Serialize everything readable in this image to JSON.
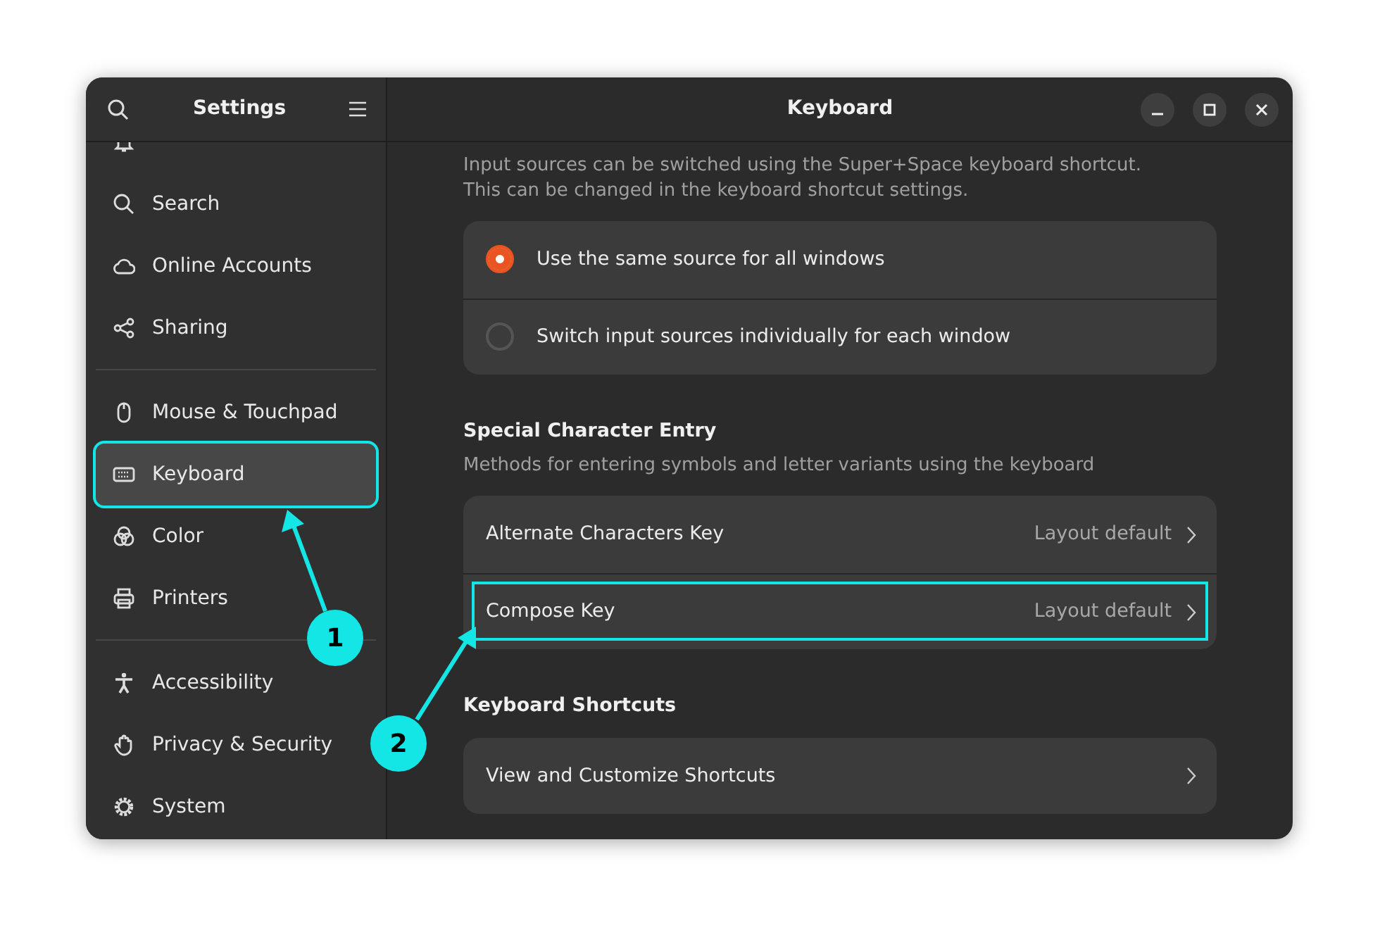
{
  "sidebar": {
    "title": "Settings",
    "groups": [
      {
        "items": [
          {
            "selected": false,
            "highlighted": false
          },
          {
            "label": "Search",
            "selected": false,
            "highlighted": false
          },
          {
            "label": "Online Accounts",
            "selected": false,
            "highlighted": false
          },
          {
            "label": "Sharing",
            "selected": false,
            "highlighted": false
          }
        ]
      },
      {
        "items": [
          {
            "label": "Mouse & Touchpad",
            "selected": false,
            "highlighted": false
          },
          {
            "label": "Keyboard",
            "selected": true,
            "highlighted": true
          },
          {
            "label": "Color",
            "selected": false,
            "highlighted": false
          },
          {
            "label": "Printers",
            "selected": false,
            "highlighted": false
          }
        ]
      },
      {
        "items": [
          {
            "label": "Accessibility",
            "selected": false,
            "highlighted": false
          },
          {
            "label": "Privacy & Security",
            "selected": false,
            "highlighted": false
          },
          {
            "label": "System",
            "selected": false,
            "highlighted": false
          }
        ]
      }
    ]
  },
  "window": {
    "title": "Keyboard"
  },
  "input_switching": {
    "description": [
      "Input sources can be switched using the Super+Space keyboard shortcut.",
      "This can be changed in the keyboard shortcut settings."
    ],
    "options": [
      {
        "label": "Use the same source for all windows",
        "selected": true
      },
      {
        "label": "Switch input sources individually for each window",
        "selected": false
      }
    ]
  },
  "special_character_entry": {
    "heading": "Special Character Entry",
    "description": "Methods for entering symbols and letter variants using the keyboard",
    "rows": [
      {
        "label": "Alternate Characters Key",
        "value": "Layout default",
        "highlighted": false
      },
      {
        "label": "Compose Key",
        "value": "Layout default",
        "highlighted": true
      }
    ]
  },
  "keyboard_shortcuts": {
    "heading": "Keyboard Shortcuts",
    "rows": [
      {
        "label": "View and Customize Shortcuts",
        "highlighted": false
      }
    ]
  },
  "annotations": [
    {
      "label": "1"
    },
    {
      "label": "2"
    }
  ]
}
